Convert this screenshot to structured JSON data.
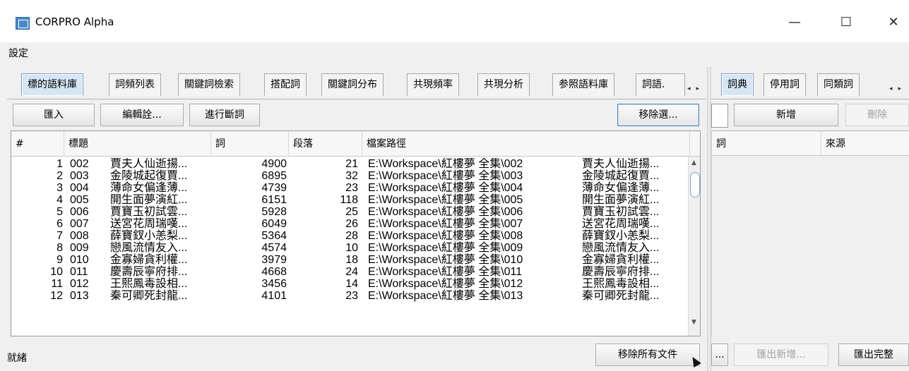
{
  "window": {
    "title": "CORPRO Alpha",
    "minimize": "—",
    "maximize": "☐",
    "close": "✕"
  },
  "menu": {
    "settings": "設定"
  },
  "left_tabs": [
    "標的語料庫",
    "詞頻列表",
    "關鍵詞檢索",
    "搭配詞",
    "關鍵詞分布",
    "共現頻率",
    "共現分析",
    "参照語料庫",
    "詞語."
  ],
  "left_buttons": {
    "import": "匯入",
    "edit": "編輯詮...",
    "segment": "進行斷詞",
    "remove_selected": "移除選..."
  },
  "table": {
    "columns": [
      "#",
      "標題",
      "詞",
      "段落",
      "檔案路徑"
    ],
    "rows": [
      [
        "1",
        "002",
        "賈夫人仙逝揚...",
        "4900",
        "21",
        "E:\\Workspace\\紅樓夢 全集\\002",
        "賈夫人仙逝揚..."
      ],
      [
        "2",
        "003",
        "金陵城起復賈...",
        "6895",
        "32",
        "E:\\Workspace\\紅樓夢 全集\\003",
        "金陵城起復賈..."
      ],
      [
        "3",
        "004",
        "薄命女偏逢薄...",
        "4739",
        "23",
        "E:\\Workspace\\紅樓夢 全集\\004",
        "薄命女偏逢薄..."
      ],
      [
        "4",
        "005",
        "開生面夢演紅...",
        "6151",
        "118",
        "E:\\Workspace\\紅樓夢 全集\\005",
        "開生面夢演紅..."
      ],
      [
        "5",
        "006",
        "賈寶玉初試雲...",
        "5928",
        "25",
        "E:\\Workspace\\紅樓夢 全集\\006",
        "賈寶玉初試雲..."
      ],
      [
        "6",
        "007",
        "送宮花周瑞嘆...",
        "6049",
        "26",
        "E:\\Workspace\\紅樓夢 全集\\007",
        "送宮花周瑞嘆..."
      ],
      [
        "7",
        "008",
        "薛寶釵小恙梨...",
        "5364",
        "28",
        "E:\\Workspace\\紅樓夢 全集\\008",
        "薛寶釵小恙梨..."
      ],
      [
        "8",
        "009",
        "戀風流情友入...",
        "4574",
        "10",
        "E:\\Workspace\\紅樓夢 全集\\009",
        "戀風流情友入..."
      ],
      [
        "9",
        "010",
        "金寡婦貪利權...",
        "3979",
        "18",
        "E:\\Workspace\\紅樓夢 全集\\010",
        "金寡婦貪利權..."
      ],
      [
        "10",
        "011",
        "慶壽辰寧府排...",
        "4668",
        "24",
        "E:\\Workspace\\紅樓夢 全集\\011",
        "慶壽辰寧府排..."
      ],
      [
        "11",
        "012",
        "王熙鳳毒設相...",
        "3456",
        "14",
        "E:\\Workspace\\紅樓夢 全集\\012",
        "王熙鳳毒設相..."
      ],
      [
        "12",
        "013",
        "秦可卿死封龍...",
        "4101",
        "23",
        "E:\\Workspace\\紅樓夢 全集\\013",
        "秦可卿死封龍..."
      ]
    ]
  },
  "status": {
    "text": "就緒",
    "remove_all": "移除所有文件"
  },
  "right_tabs": [
    "詞典",
    "停用詞",
    "同類詞"
  ],
  "right_buttons": {
    "add": "新增",
    "delete": "刪除",
    "more": "...",
    "export_new": "匯出新增...",
    "export_full": "匯出完整"
  },
  "right_table": {
    "columns": [
      "詞",
      "來源"
    ]
  },
  "colors": {
    "active_tab": "#d7e6f5",
    "focus_border": "#4d89c7"
  }
}
